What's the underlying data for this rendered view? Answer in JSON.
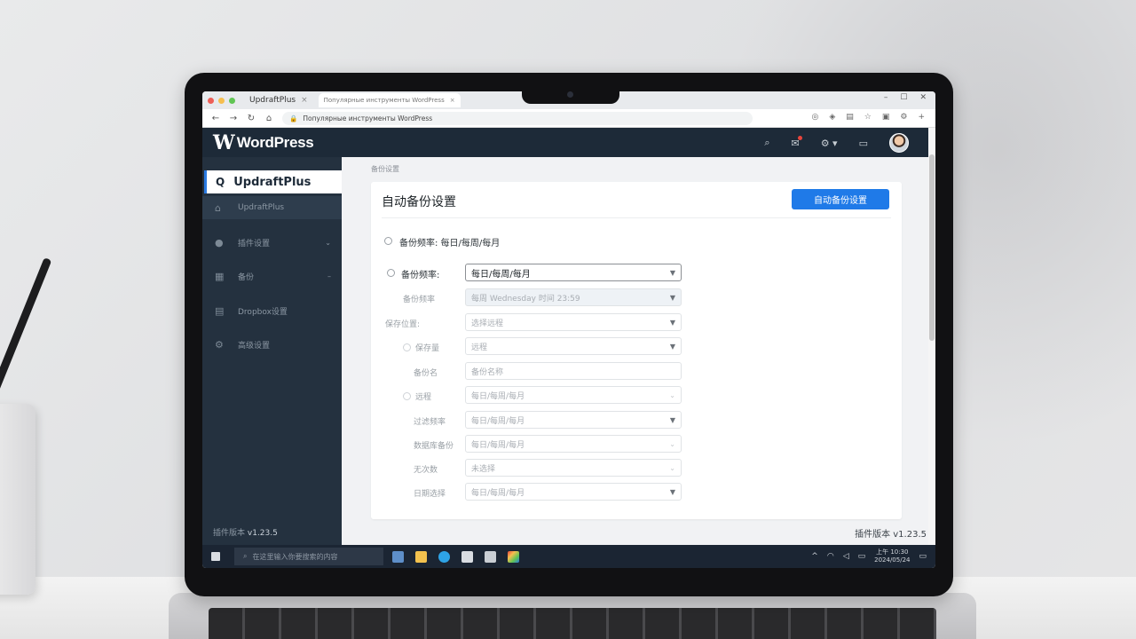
{
  "browser": {
    "tabs": [
      {
        "label": "UpdraftPlus"
      },
      {
        "label": "Популярные инструменты WordPress"
      }
    ],
    "address": "Популярные инструменты WordPress",
    "nav": {
      "back": "←",
      "forward": "→",
      "reload": "↻",
      "home": "⌂"
    },
    "window_controls": {
      "minimize": "–",
      "maximize": "☐",
      "close": "✕"
    }
  },
  "wp": {
    "logo_w": "W",
    "logo_text": "WordPress",
    "toolbar_icons": [
      "search-icon",
      "notifications-icon",
      "settings-icon",
      "comments-icon"
    ]
  },
  "sidebar": {
    "header": "UpdraftPlus",
    "items": [
      {
        "label": "UpdraftPlus",
        "icon": "home-icon"
      },
      {
        "label": "插件设置",
        "icon": "user-icon"
      },
      {
        "label": "备份",
        "icon": "grid-icon"
      },
      {
        "label": "Dropbox设置",
        "icon": "archive-icon"
      },
      {
        "label": "高级设置",
        "icon": "gear-icon"
      }
    ],
    "version_label": "插件版本",
    "version_value": "v1.23.5"
  },
  "main": {
    "breadcrumb": "备份设置",
    "card": {
      "title": "自动备份设置",
      "button": "自动备份设置",
      "rows": [
        {
          "label": "备份频率: 每日/每周/每月",
          "value": ""
        },
        {
          "label": "备份频率:",
          "value": "每日/每周/每月"
        },
        {
          "label": "备份频率",
          "value": "每周 Wednesday 时间 23:59"
        },
        {
          "label": "保存位置:",
          "value": "选择远程"
        },
        {
          "label": "保存量",
          "value": "远程"
        },
        {
          "label": "备份名",
          "value": "备份名称"
        },
        {
          "label": "远程",
          "value": "每日/每周/每月"
        },
        {
          "label": "过滤频率",
          "value": "每日/每周/每月"
        },
        {
          "label": "数据库备份",
          "value": "每日/每周/每月"
        },
        {
          "label": "无次数",
          "value": "未选择"
        },
        {
          "label": "日期选择",
          "value": "每日/每周/每月"
        }
      ]
    },
    "footer_label": "插件版本",
    "footer_version": "v1.23.5"
  },
  "taskbar": {
    "search_placeholder": "在这里输入你要搜索的内容",
    "time": "上午 10:30",
    "date": "2024/05/24"
  },
  "colors": {
    "wp_dark": "#1d2a38",
    "sidebar": "#24313f",
    "accent": "#1f7ae8"
  }
}
